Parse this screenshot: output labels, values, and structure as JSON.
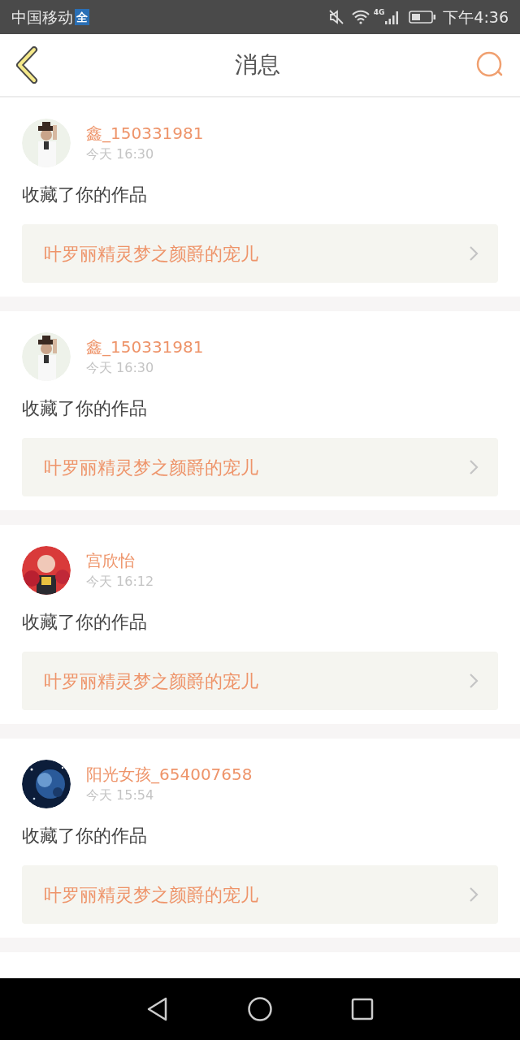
{
  "status_bar": {
    "carrier": "中国移动",
    "carrier_badge": "全",
    "network": "4G",
    "time": "下午4:36"
  },
  "header": {
    "title": "消息"
  },
  "messages": [
    {
      "user": "鑫_150331981",
      "time": "今天 16:30",
      "action": "收藏了你的作品",
      "work": "叶罗丽精灵梦之颜爵的宠儿"
    },
    {
      "user": "鑫_150331981",
      "time": "今天 16:30",
      "action": "收藏了你的作品",
      "work": "叶罗丽精灵梦之颜爵的宠儿"
    },
    {
      "user": "宫欣怡",
      "time": "今天 16:12",
      "action": "收藏了你的作品",
      "work": "叶罗丽精灵梦之颜爵的宠儿"
    },
    {
      "user": "阳光女孩_654007658",
      "time": "今天 15:54",
      "action": "收藏了你的作品",
      "work": "叶罗丽精灵梦之颜爵的宠儿"
    }
  ]
}
